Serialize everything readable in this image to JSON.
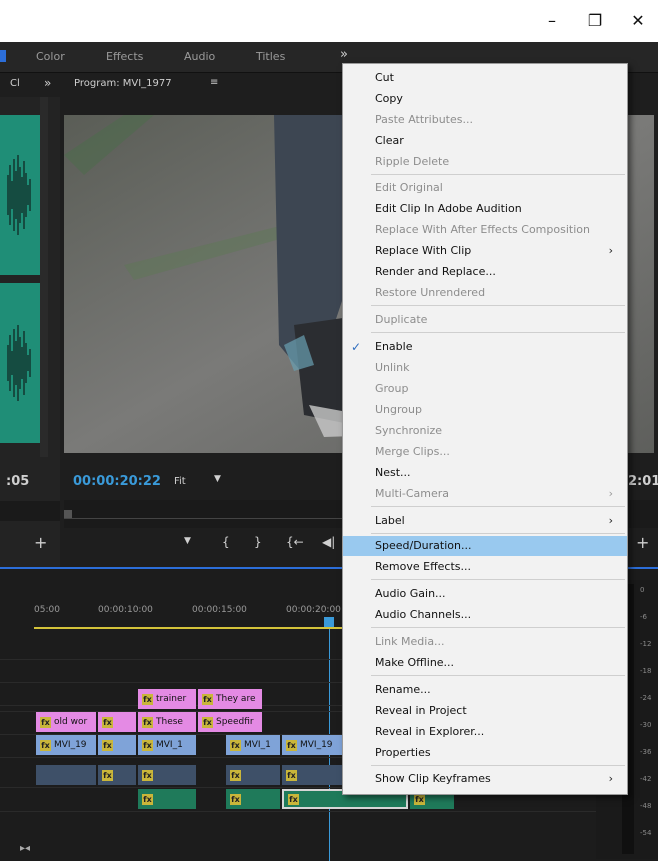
{
  "window": {
    "minimize": "–",
    "restore": "❐",
    "close": "✕"
  },
  "workspace_tabs": [
    "Color",
    "Effects",
    "Audio",
    "Titles"
  ],
  "workspace_more": "»",
  "source_panel": {
    "tab": "Cl",
    "more": "»",
    "timecode": ":05",
    "add": "+"
  },
  "program_panel": {
    "title": "Program: MVI_1977",
    "menu_icon": "≡",
    "timecode": "00:00:20:22",
    "fit": "Fit",
    "right_timecode": "2:01",
    "controls": [
      "▼",
      "{",
      "}",
      "{←",
      "◀|"
    ],
    "add": "+"
  },
  "timeline": {
    "ruler_labels": [
      "05:00",
      "00:00:10:00",
      "00:00:15:00",
      "00:00:20:00"
    ],
    "clips": [
      {
        "label": "trainer",
        "color": "#e48ae4"
      },
      {
        "label": "They are",
        "color": "#e48ae4"
      },
      {
        "label": "old wor",
        "color": "#e48ae4"
      },
      {
        "label": "",
        "color": "#e48ae4"
      },
      {
        "label": "These",
        "color": "#e48ae4"
      },
      {
        "label": "Speedfir",
        "color": "#e48ae4"
      },
      {
        "label": "MVI_19",
        "color": "#7fa3d8"
      },
      {
        "label": "",
        "color": "#7fa3d8"
      },
      {
        "label": "MVI_1",
        "color": "#7fa3d8"
      },
      {
        "label": "MVI_1",
        "color": "#7fa3d8"
      },
      {
        "label": "MVI_19",
        "color": "#7fa3d8"
      }
    ],
    "fx_label": "fx",
    "end_icon": "▸◂"
  },
  "vu_labels": [
    "0",
    "-6",
    "-12",
    "-18",
    "-24",
    "-30",
    "-36",
    "-42",
    "-48",
    "-54"
  ],
  "context_menu": {
    "items": [
      {
        "label": "Cut",
        "disabled": false
      },
      {
        "label": "Copy",
        "disabled": false
      },
      {
        "label": "Paste Attributes...",
        "disabled": true
      },
      {
        "label": "Clear",
        "disabled": false
      },
      {
        "label": "Ripple Delete",
        "disabled": true
      },
      {
        "label": "Edit Original",
        "disabled": true
      },
      {
        "label": "Edit Clip In Adobe Audition",
        "disabled": false
      },
      {
        "label": "Replace With After Effects Composition",
        "disabled": true
      },
      {
        "label": "Replace With Clip",
        "disabled": false,
        "submenu": true
      },
      {
        "label": "Render and Replace...",
        "disabled": false
      },
      {
        "label": "Restore Unrendered",
        "disabled": true
      },
      {
        "label": "Duplicate",
        "disabled": true
      },
      {
        "label": "Enable",
        "disabled": false,
        "checked": true
      },
      {
        "label": "Unlink",
        "disabled": true
      },
      {
        "label": "Group",
        "disabled": true
      },
      {
        "label": "Ungroup",
        "disabled": true
      },
      {
        "label": "Synchronize",
        "disabled": true
      },
      {
        "label": "Merge Clips...",
        "disabled": true
      },
      {
        "label": "Nest...",
        "disabled": false
      },
      {
        "label": "Multi-Camera",
        "disabled": true,
        "submenu": true
      },
      {
        "label": "Label",
        "disabled": false,
        "submenu": true
      },
      {
        "label": "Speed/Duration...",
        "disabled": false,
        "highlighted": true
      },
      {
        "label": "Remove Effects...",
        "disabled": false
      },
      {
        "label": "Audio Gain...",
        "disabled": false
      },
      {
        "label": "Audio Channels...",
        "disabled": false
      },
      {
        "label": "Link Media...",
        "disabled": true
      },
      {
        "label": "Make Offline...",
        "disabled": false
      },
      {
        "label": "Rename...",
        "disabled": false
      },
      {
        "label": "Reveal in Project",
        "disabled": false
      },
      {
        "label": "Reveal in Explorer...",
        "disabled": false
      },
      {
        "label": "Properties",
        "disabled": false
      },
      {
        "label": "Show Clip Keyframes",
        "disabled": false,
        "submenu": true
      }
    ],
    "submenu_arrow": "›",
    "check_mark": "✓"
  }
}
